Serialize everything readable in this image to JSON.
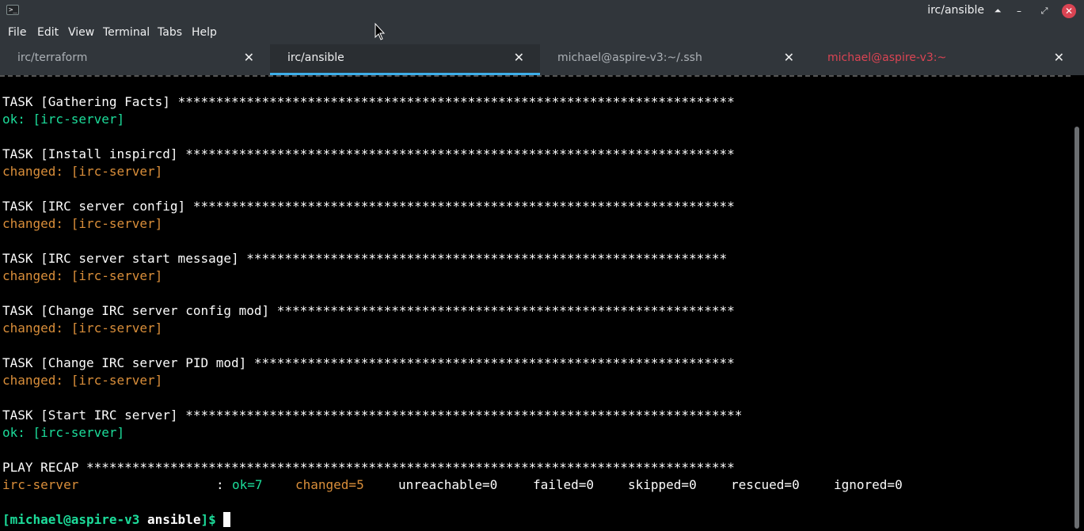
{
  "window": {
    "title": "irc/ansible",
    "keep_above_glyph": "⏶",
    "minimize_glyph": "–",
    "maximize_glyph": "⤢",
    "close_glyph": "✕"
  },
  "menubar": {
    "items": [
      "File",
      "Edit",
      "View",
      "Terminal",
      "Tabs",
      "Help"
    ]
  },
  "tabs": [
    {
      "label": "irc/terraform",
      "active": false
    },
    {
      "label": "irc/ansible",
      "active": true
    },
    {
      "label": "michael@aspire-v3:~/.ssh",
      "active": false
    },
    {
      "label": "michael@aspire-v3:~",
      "active": false,
      "alert": true
    }
  ],
  "tab_close_glyph": "✕",
  "terminal": {
    "tasks": [
      {
        "title": "TASK [Gathering Facts] ",
        "stars": "*************************************************************************",
        "result": "ok: [irc-server]",
        "status": "ok"
      },
      {
        "title": "TASK [Install inspircd] ",
        "stars": "************************************************************************",
        "result": "changed: [irc-server]",
        "status": "changed"
      },
      {
        "title": "TASK [IRC server config] ",
        "stars": "***********************************************************************",
        "result": "changed: [irc-server]",
        "status": "changed"
      },
      {
        "title": "TASK [IRC server start message] ",
        "stars": "***************************************************************",
        "result": "changed: [irc-server]",
        "status": "changed"
      },
      {
        "title": "TASK [Change IRC server config mod] ",
        "stars": "************************************************************",
        "result": "changed: [irc-server]",
        "status": "changed"
      },
      {
        "title": "TASK [Change IRC server PID mod] ",
        "stars": "***************************************************************",
        "result": "changed: [irc-server]",
        "status": "changed"
      },
      {
        "title": "TASK [Start IRC server] ",
        "stars": "*************************************************************************",
        "result": "ok: [irc-server]",
        "status": "ok"
      }
    ],
    "recap_title": "PLAY RECAP ",
    "recap_stars": "*************************************************************************************",
    "recap": {
      "host": "irc-server",
      "sep": ": ",
      "ok": "ok=7",
      "changed": "changed=5",
      "unreachable": "unreachable=0",
      "failed": "failed=0",
      "skipped": "skipped=0",
      "rescued": "rescued=0",
      "ignored": "ignored=0"
    },
    "prompt": {
      "user_host": "[michael@aspire-v3",
      "dir": " ansible",
      "close": "]$",
      "trail": " "
    }
  },
  "colors": {
    "ok": "#1cdc9a",
    "changed": "#d98e3a",
    "accent": "#3daee9",
    "alert": "#da4453"
  }
}
